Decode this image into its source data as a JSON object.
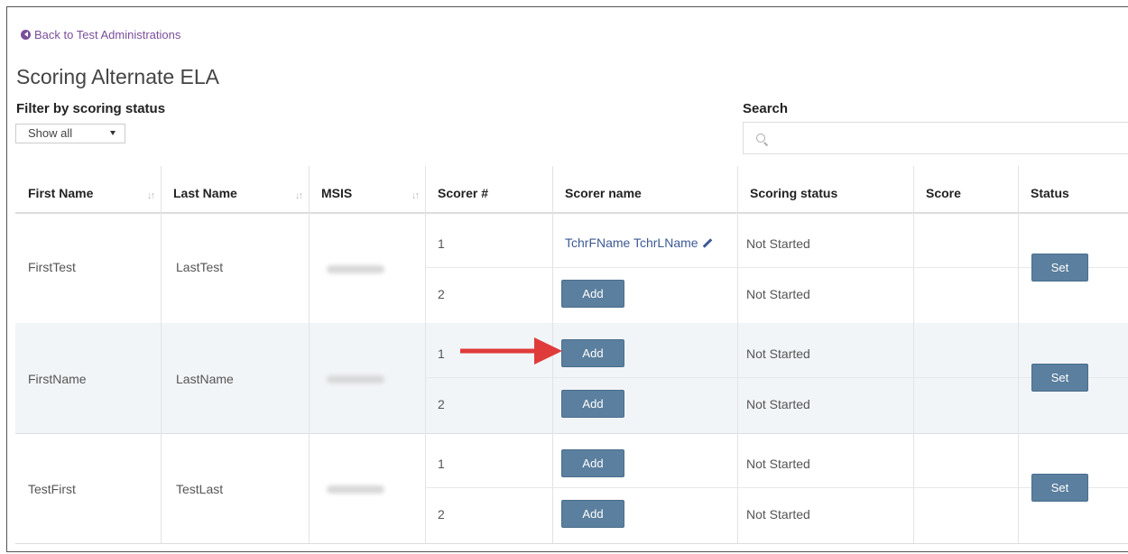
{
  "nav": {
    "back_label": "Back to Test Administrations"
  },
  "page": {
    "title": "Scoring Alternate ELA"
  },
  "filter": {
    "label": "Filter by scoring status",
    "selected": "Show all"
  },
  "search": {
    "label": "Search",
    "placeholder": ""
  },
  "table": {
    "headers": [
      "First Name",
      "Last Name",
      "MSIS",
      "Scorer #",
      "Scorer name",
      "Scoring status",
      "Score",
      "Status"
    ],
    "rows": [
      {
        "first_name": "FirstTest",
        "last_name": "LastTest",
        "msis_redacted": true,
        "scorers": [
          {
            "number": "1",
            "name": "TchrFName TchrLName",
            "action": null,
            "scoring_status": "Not Started"
          },
          {
            "number": "2",
            "name": null,
            "action": "Add",
            "scoring_status": "Not Started"
          }
        ],
        "status_action": "Set"
      },
      {
        "first_name": "FirstName",
        "last_name": "LastName",
        "msis_redacted": true,
        "scorers": [
          {
            "number": "1",
            "name": null,
            "action": "Add",
            "scoring_status": "Not Started"
          },
          {
            "number": "2",
            "name": null,
            "action": "Add",
            "scoring_status": "Not Started"
          }
        ],
        "status_action": "Set"
      },
      {
        "first_name": "TestFirst",
        "last_name": "TestLast",
        "msis_redacted": true,
        "scorers": [
          {
            "number": "1",
            "name": null,
            "action": "Add",
            "scoring_status": "Not Started"
          },
          {
            "number": "2",
            "name": null,
            "action": "Add",
            "scoring_status": "Not Started"
          }
        ],
        "status_action": "Set"
      }
    ]
  },
  "colors": {
    "accent": "#5b7f9e",
    "link": "#3d5a94",
    "back_link": "#7a4f9a",
    "annotation_arrow": "#e03b3b",
    "alt_row": "#f2f5f8"
  }
}
